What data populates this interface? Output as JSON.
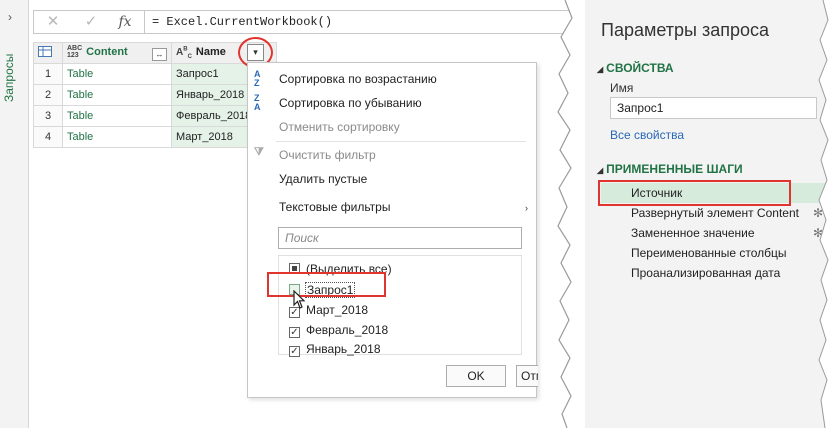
{
  "queries_pane": {
    "label": "Запросы",
    "expand_glyph": "›"
  },
  "formula_bar": {
    "cancel_glyph": "✕",
    "confirm_glyph": "✓",
    "fx_glyph": "fx",
    "formula": "= Excel.CurrentWorkbook()"
  },
  "table": {
    "type_icon_col1": "ABC\n123",
    "type_icon_col2": "ABC",
    "columns": [
      "Content",
      "Name"
    ],
    "rows": [
      {
        "n": "1",
        "content": "Table",
        "name": "Запрос1"
      },
      {
        "n": "2",
        "content": "Table",
        "name": "Январь_2018"
      },
      {
        "n": "3",
        "content": "Table",
        "name": "Февраль_2018"
      },
      {
        "n": "4",
        "content": "Table",
        "name": "Март_2018"
      }
    ],
    "expand_glyph": "↔",
    "filter_glyph": "▾"
  },
  "filter_menu": {
    "sort_asc": "Сортировка по возрастанию",
    "sort_desc": "Сортировка по убыванию",
    "clear_sort": "Отменить сортировку",
    "clear_filter": "Очистить фильтр",
    "remove_empty": "Удалить пустые",
    "text_filters": "Текстовые фильтры",
    "search_placeholder": "Поиск",
    "items": [
      {
        "label": "(Выделить все)",
        "state": "partial"
      },
      {
        "label": "Запрос1",
        "state": "unchecked"
      },
      {
        "label": "Март_2018",
        "state": "checked"
      },
      {
        "label": "Февраль_2018",
        "state": "checked"
      },
      {
        "label": "Январь_2018",
        "state": "checked"
      }
    ],
    "ok_label": "OK",
    "cancel_label": "Отмена"
  },
  "query_settings": {
    "title": "Параметры запроса",
    "properties_header": "СВОЙСТВА",
    "name_label": "Имя",
    "name_value": "Запрос1",
    "all_properties": "Все свойства",
    "steps_header": "ПРИМЕНЕННЫЕ ШАГИ",
    "steps": [
      {
        "label": "Источник",
        "selected": true,
        "gear": false
      },
      {
        "label": "Развернутый элемент Content",
        "selected": false,
        "gear": true
      },
      {
        "label": "Замененное значение",
        "selected": false,
        "gear": true
      },
      {
        "label": "Переименованные столбцы",
        "selected": false,
        "gear": false
      },
      {
        "label": "Проанализированная дата",
        "selected": false,
        "gear": false
      }
    ]
  },
  "colors": {
    "accent_green": "#217346",
    "highlight_red": "#e0342e",
    "link_blue": "#2a68b8"
  }
}
